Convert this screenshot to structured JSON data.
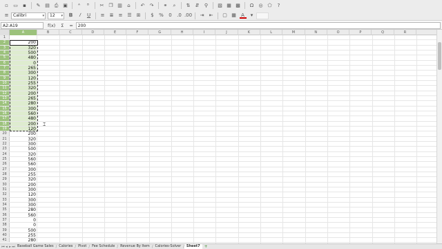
{
  "toolbar": {
    "font_name": "Calibri",
    "font_size": "12",
    "font_color": "#cc0000",
    "highlight_color": "#ffffff"
  },
  "formula_bar": {
    "name_box": "A2:A19",
    "fx_label": "f(x)",
    "sum_label": "Σ",
    "equals_label": "=",
    "input_value": "200"
  },
  "columns": [
    "A",
    "B",
    "C",
    "D",
    "E",
    "F",
    "G",
    "H",
    "I",
    "J",
    "K",
    "L",
    "M",
    "N",
    "O",
    "P",
    "Q",
    "R"
  ],
  "row_numbers": [
    "1",
    "2",
    "3",
    "4",
    "5",
    "6",
    "7",
    "8",
    "9",
    "10",
    "11",
    "12",
    "13",
    "14",
    "15",
    "16",
    "17",
    "18",
    "19",
    "20",
    "21",
    "22",
    "23",
    "24",
    "25",
    "26",
    "27",
    "28",
    "29",
    "30",
    "31",
    "32",
    "33",
    "34",
    "35",
    "36",
    "37",
    "38",
    "39",
    "40",
    "41"
  ],
  "column_a": [
    "",
    "200",
    "320",
    "500",
    "480",
    "0",
    "265",
    "300",
    "120",
    "255",
    "320",
    "200",
    "265",
    "280",
    "300",
    "560",
    "480",
    "200",
    "120",
    "200",
    "320",
    "300",
    "500",
    "320",
    "560",
    "560",
    "300",
    "255",
    "320",
    "200",
    "300",
    "120",
    "300",
    "300",
    "280",
    "560",
    "0",
    "0",
    "500",
    "255",
    "280"
  ],
  "colors": {
    "selection_header": "#9cc27c",
    "selection_fill": "#deeccf"
  },
  "sheet_tabs": [
    "Baseball Game Sales",
    "Calories",
    "Pivot",
    "Fee Schedule",
    "Revenue By Item",
    "Calories-Solver",
    "Sheet7"
  ],
  "active_tab": "Sheet7"
}
